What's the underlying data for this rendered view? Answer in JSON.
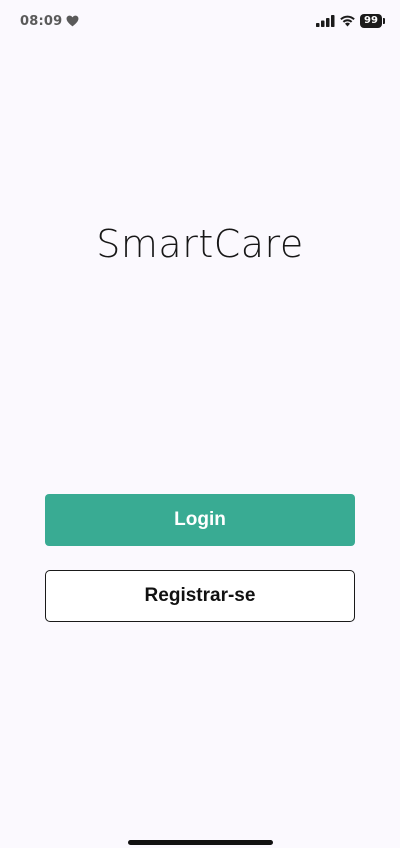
{
  "status_bar": {
    "time": "08:09",
    "battery": "99",
    "icons": [
      "heart-icon",
      "cellular-signal-icon",
      "wifi-icon",
      "battery-icon"
    ]
  },
  "app": {
    "logo_text": "SmartCare"
  },
  "actions": {
    "login_label": "Login",
    "register_label": "Registrar-se"
  },
  "colors": {
    "accent": "#39ab93",
    "background": "#fbf9fe",
    "text": "#171717"
  }
}
